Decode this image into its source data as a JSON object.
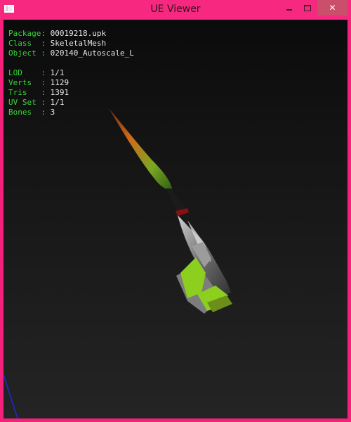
{
  "window": {
    "title": "UE Viewer",
    "close_glyph": "✕"
  },
  "info": {
    "package_label": "Package: ",
    "package_value": "00019218.upk",
    "class_label": "Class  : ",
    "class_value": "SkeletalMesh",
    "object_label": "Object : ",
    "object_value": "020140_Autoscale_L",
    "lod_label": "LOD    : ",
    "lod_value": "1/1",
    "verts_label": "Verts  : ",
    "verts_value": "1129",
    "tris_label": "Tris   : ",
    "tris_value": "1391",
    "uvset_label": "UV Set : ",
    "uvset_value": "1/1",
    "bones_label": "Bones  : ",
    "bones_value": "3"
  },
  "colors": {
    "label": "#37d33a",
    "value": "#e6e6e6",
    "frame": "#f4207a",
    "mesh_green": "#8ccf1f",
    "mesh_gray": "#9a9a9a",
    "axis_blue": "#1a2bd8"
  },
  "icons": [
    "app-icon",
    "minimize-icon",
    "maximize-icon",
    "close-icon"
  ]
}
